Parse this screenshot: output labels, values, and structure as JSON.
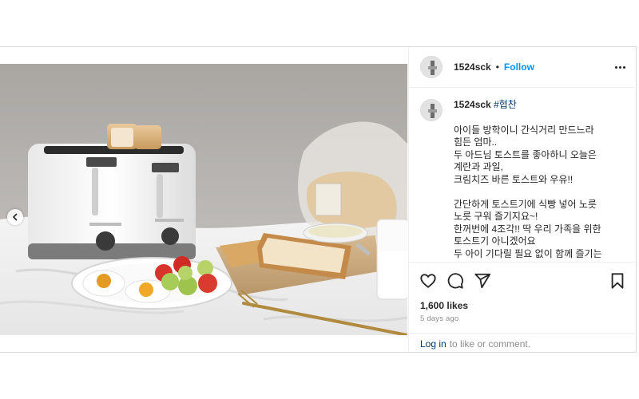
{
  "post": {
    "username": "1524sck",
    "separator": "•",
    "follow_label": "Follow",
    "more_icon": "more-horizontal-icon",
    "media": {
      "alt": "",
      "prev_icon": "chevron-left-icon"
    },
    "caption": {
      "username": "1524sck",
      "hashtag": "#협찬",
      "text": "아이들 방학이니 간식거리 만드느라\n힘든 엄마..\n두 아드님 토스트를 좋아하니 오늘은\n계란과 과일,\n크림치즈 바른 토스트와 우유!!\n\n간단하게 토스트기에 식빵 넣어 노릇\n노릇 구워 즐기지요~!\n한꺼번에 4조각!! 딱 우리 가족을 위한\n토스트기 아니겠어요\n두 아이 기다릴 필요 없이 함께 즐기는"
    },
    "actions": {
      "like_icon": "heart-icon",
      "comment_icon": "comment-icon",
      "share_icon": "share-icon",
      "save_icon": "bookmark-icon"
    },
    "likes": "1,600 likes",
    "age": "5 days ago",
    "login": {
      "link": "Log in",
      "text": "to like or comment."
    }
  },
  "colors": {
    "link_blue": "#0095f6",
    "hashtag": "#00376b",
    "muted": "#8e8e8e",
    "border": "#dbdbdb"
  }
}
